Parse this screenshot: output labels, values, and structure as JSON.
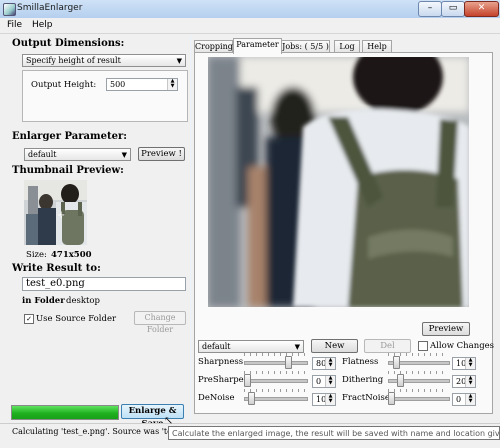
{
  "window": {
    "title": "SmillaEnlarger",
    "min_glyph": "–",
    "max_glyph": "▭",
    "close_glyph": "✕"
  },
  "menu": [
    "File",
    "Help"
  ],
  "output_dimensions": {
    "heading": "Output Dimensions:",
    "mode": "Specify height of result",
    "height_label": "Output Height:",
    "height_value": "500"
  },
  "enlarger_parameter": {
    "heading": "Enlarger Parameter:",
    "preset": "default",
    "preview_button": "Preview !"
  },
  "thumbnail": {
    "heading": "Thumbnail Preview:",
    "size_label": "Size:",
    "size_value": "471x500"
  },
  "write_result": {
    "heading": "Write Result to:",
    "filename": "test_e0.png",
    "folder_label": "in Folder",
    "folder_value": "desktop",
    "use_source_folder_label": "Use Source Folder",
    "use_source_folder_checked": true,
    "change_folder_button": "Change Folder"
  },
  "progress": {
    "fraction": 1.0
  },
  "enlarge_save_button": "Enlarge & Save",
  "status_text": "Calculating 'test_e.png'.  Source was 'test.png'.   De",
  "tooltip": "Calculate the enlarged image, the result will be saved with name and location given above.",
  "tabs": [
    "Cropping",
    "Parameter",
    "Jobs: ( 5/5 )",
    "Log",
    "Help"
  ],
  "active_tab": "Parameter",
  "parameter_tab": {
    "preview_button": "Preview",
    "preset": "default",
    "new_button": "New",
    "del_button": "Del",
    "allow_changes_label": "Allow Changes",
    "allow_changes_checked": false,
    "params": [
      {
        "name": "Sharpness",
        "value": "80"
      },
      {
        "name": "Flatness",
        "value": "10"
      },
      {
        "name": "PreSharpen",
        "value": "0"
      },
      {
        "name": "Dithering",
        "value": "20"
      },
      {
        "name": "DeNoise",
        "value": "10"
      },
      {
        "name": "FractNoise",
        "value": "0"
      }
    ]
  },
  "colors": {
    "progress_green": "#1fb11f",
    "window_bg": "#f0f0f0",
    "titlebar": "#cfe2f6"
  }
}
